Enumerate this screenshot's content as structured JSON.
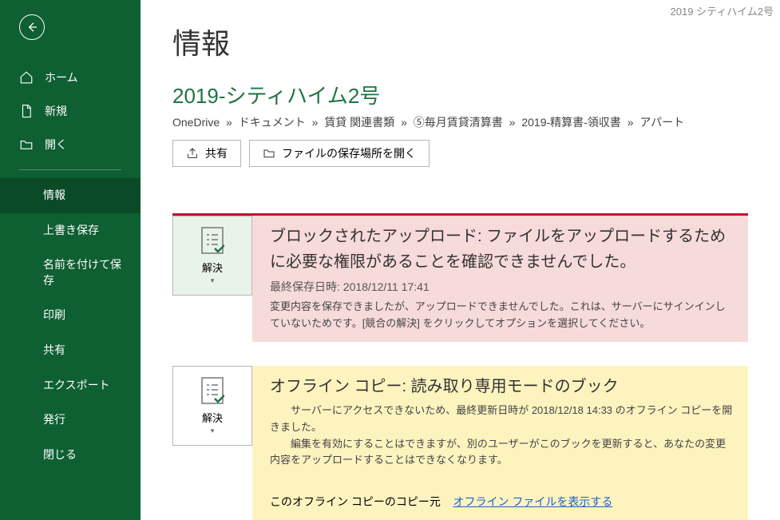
{
  "header_trail": "2019 シティハイム2号",
  "sidebar": {
    "home": "ホーム",
    "new": "新規",
    "open": "開く",
    "info": "情報",
    "save": "上書き保存",
    "saveas": "名前を付けて保存",
    "print": "印刷",
    "share": "共有",
    "export": "エクスポート",
    "publish": "発行",
    "close": "閉じる"
  },
  "page": {
    "title": "情報",
    "file_name": "2019-シティハイム2号",
    "path": {
      "p0": "OneDrive",
      "p1": "ドキュメント",
      "p2": "賃貸 関連書類",
      "p3": "⑤毎月賃貸清算書",
      "p4": "2019-精算書-領収書",
      "p5": "アパート",
      "sep": "»"
    },
    "actions": {
      "share": "共有",
      "open_location": "ファイルの保存場所を開く"
    }
  },
  "tile": {
    "resolve": "解決"
  },
  "error": {
    "heading": "ブロックされたアップロード: ファイルをアップロードするために必要な権限があることを確認できませんでした。",
    "meta": "最終保存日時: 2018/12/11 17:41",
    "desc": "変更内容を保存できましたが、アップロードできませんでした。これは、サーバーにサインインしていないためです。[競合の解決] をクリックしてオプションを選択してください。"
  },
  "warn": {
    "heading": "オフライン コピー: 読み取り専用モードのブック",
    "line1": "　　サーバーにアクセスできないため、最終更新日時が 2018/12/18 14:33 のオフライン コピーを開きました。",
    "line2": "　　編集を有効にすることはできますが、別のユーザーがこのブックを更新すると、あなたの変更内容をアップロードすることはできなくなります。",
    "footer_label": "このオフライン コピーのコピー元",
    "link": "オフライン ファイルを表示する"
  }
}
